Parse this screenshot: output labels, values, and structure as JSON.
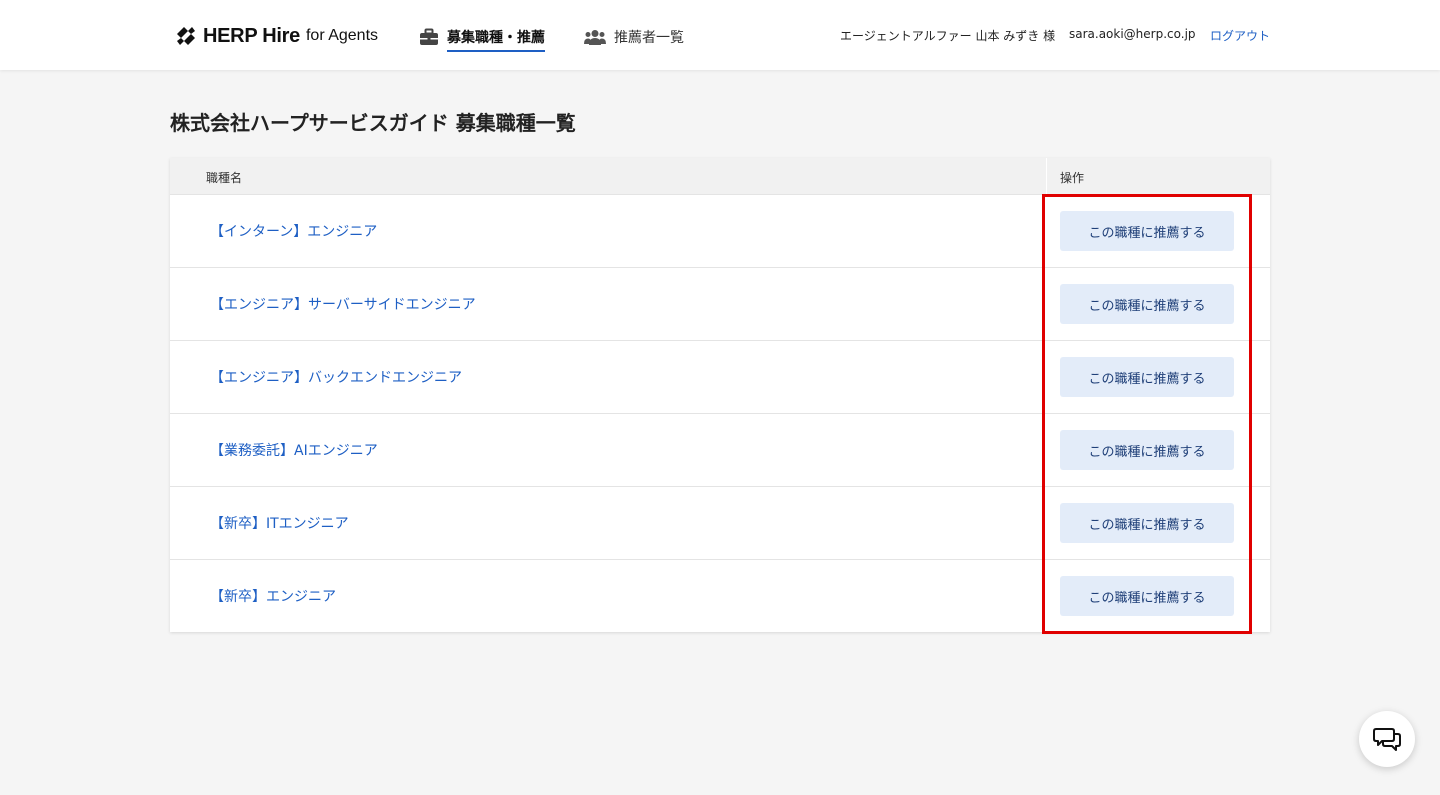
{
  "header": {
    "logo_brand": "HERP Hire",
    "logo_sub": "for Agents",
    "nav": [
      {
        "label": "募集職種・推薦",
        "icon": "briefcase-icon",
        "active": true
      },
      {
        "label": "推薦者一覧",
        "icon": "users-icon",
        "active": false
      }
    ],
    "user_name": "エージェントアルファー 山本 みずき 様",
    "user_email": "sara.aoki@herp.co.jp",
    "logout_label": "ログアウト"
  },
  "page": {
    "title": "株式会社ハープサービスガイド 募集職種一覧"
  },
  "table": {
    "columns": [
      "職種名",
      "操作"
    ],
    "rows": [
      {
        "job": "【インターン】エンジニア",
        "action": "この職種に推薦する"
      },
      {
        "job": "【エンジニア】サーバーサイドエンジニア",
        "action": "この職種に推薦する"
      },
      {
        "job": "【エンジニア】バックエンドエンジニア",
        "action": "この職種に推薦する"
      },
      {
        "job": "【業務委託】AIエンジニア",
        "action": "この職種に推薦する"
      },
      {
        "job": "【新卒】ITエンジニア",
        "action": "この職種に推薦する"
      },
      {
        "job": "【新卒】エンジニア",
        "action": "この職種に推薦する"
      }
    ]
  },
  "colors": {
    "accent": "#1e5fc4",
    "button_bg": "#e3ecf9",
    "highlight": "#e00000"
  },
  "chat": {
    "icon": "chat-icon"
  }
}
